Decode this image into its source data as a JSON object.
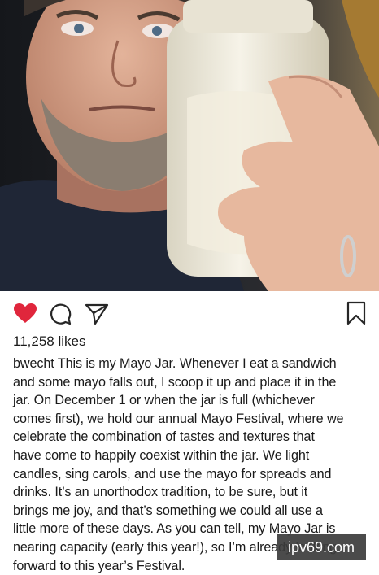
{
  "post": {
    "likes": "11,258 likes",
    "username": "bwecht",
    "caption_lines": [
      " This is my Mayo Jar. Whenever I eat a sandwich",
      "and some mayo falls out, I scoop it up and place it in the",
      "jar. On December 1 or when the jar is full (whichever",
      "comes first), we hold our annual Mayo Festival, where we",
      "celebrate the combination of tastes and textures that",
      "have come to happily coexist within the jar. We light",
      "candles, sing carols, and use the mayo for spreads and",
      "drinks. It’s an unorthodox tradition, to be sure, but it",
      "brings me joy, and that’s something we could all use a",
      "little more of these days. As you can tell, my Mayo Jar is",
      "nearing capacity (early this year!), so I’m already looking",
      "forward to this year’s Festival."
    ]
  },
  "watermark": "ipv69.com",
  "icons": {
    "like": "heart-icon",
    "comment": "comment-icon",
    "share": "send-icon",
    "save": "bookmark-icon"
  },
  "colors": {
    "like": "#e0263c",
    "icon_stroke": "#262626"
  }
}
